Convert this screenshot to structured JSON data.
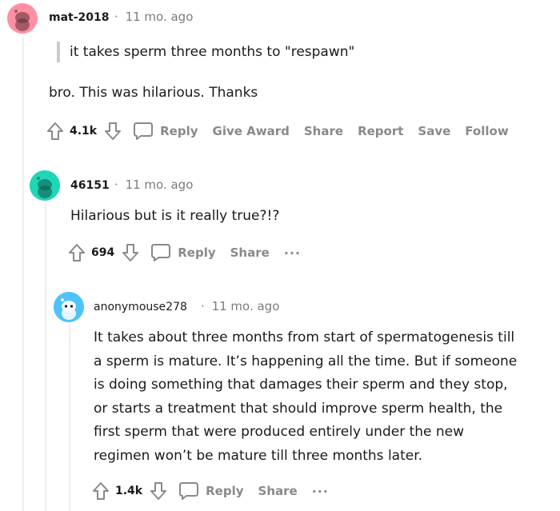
{
  "comments": [
    {
      "username": "mat-2018",
      "separator": "·",
      "time": "11 mo. ago",
      "quote": "it takes sperm three months to \"respawn\"",
      "body": "bro. This was hilarious. Thanks",
      "votes": "4.1k",
      "actions": [
        "Reply",
        "Give Award",
        "Share",
        "Report",
        "Save",
        "Follow"
      ],
      "avatar_color": "#ff8fa3"
    },
    {
      "username": "46151",
      "separator": "·",
      "time": "11 mo. ago",
      "body": "Hilarious but is it really true?!?",
      "votes": "694",
      "actions": [
        "Reply",
        "Share"
      ],
      "more": "···",
      "avatar_color": "#1fd6b6"
    },
    {
      "username": "anonymouse278",
      "separator": "·",
      "time": "11 mo. ago",
      "body_lines": [
        "It takes about three months from start of spermatogenesis till",
        "a sperm is mature. It’s happening all the time. But if someone",
        "is doing something that damages their sperm and they stop,",
        "or starts a treatment that should improve sperm health, the",
        "first sperm that were produced entirely under the new",
        "regimen won’t be mature till three months later."
      ],
      "votes": "1.4k",
      "actions": [
        "Reply",
        "Share"
      ],
      "more": "···",
      "avatar_color": "#4fc3f7"
    }
  ],
  "icons": {
    "upvote": "upvote-arrow-icon",
    "downvote": "downvote-arrow-icon",
    "reply": "speech-bubble-icon",
    "avatar": "snoo-avatar-icon"
  },
  "colors": {
    "action_gray": "#878a8c",
    "thread_line": "#edeff1",
    "quote_bar": "#c8cbcd"
  }
}
